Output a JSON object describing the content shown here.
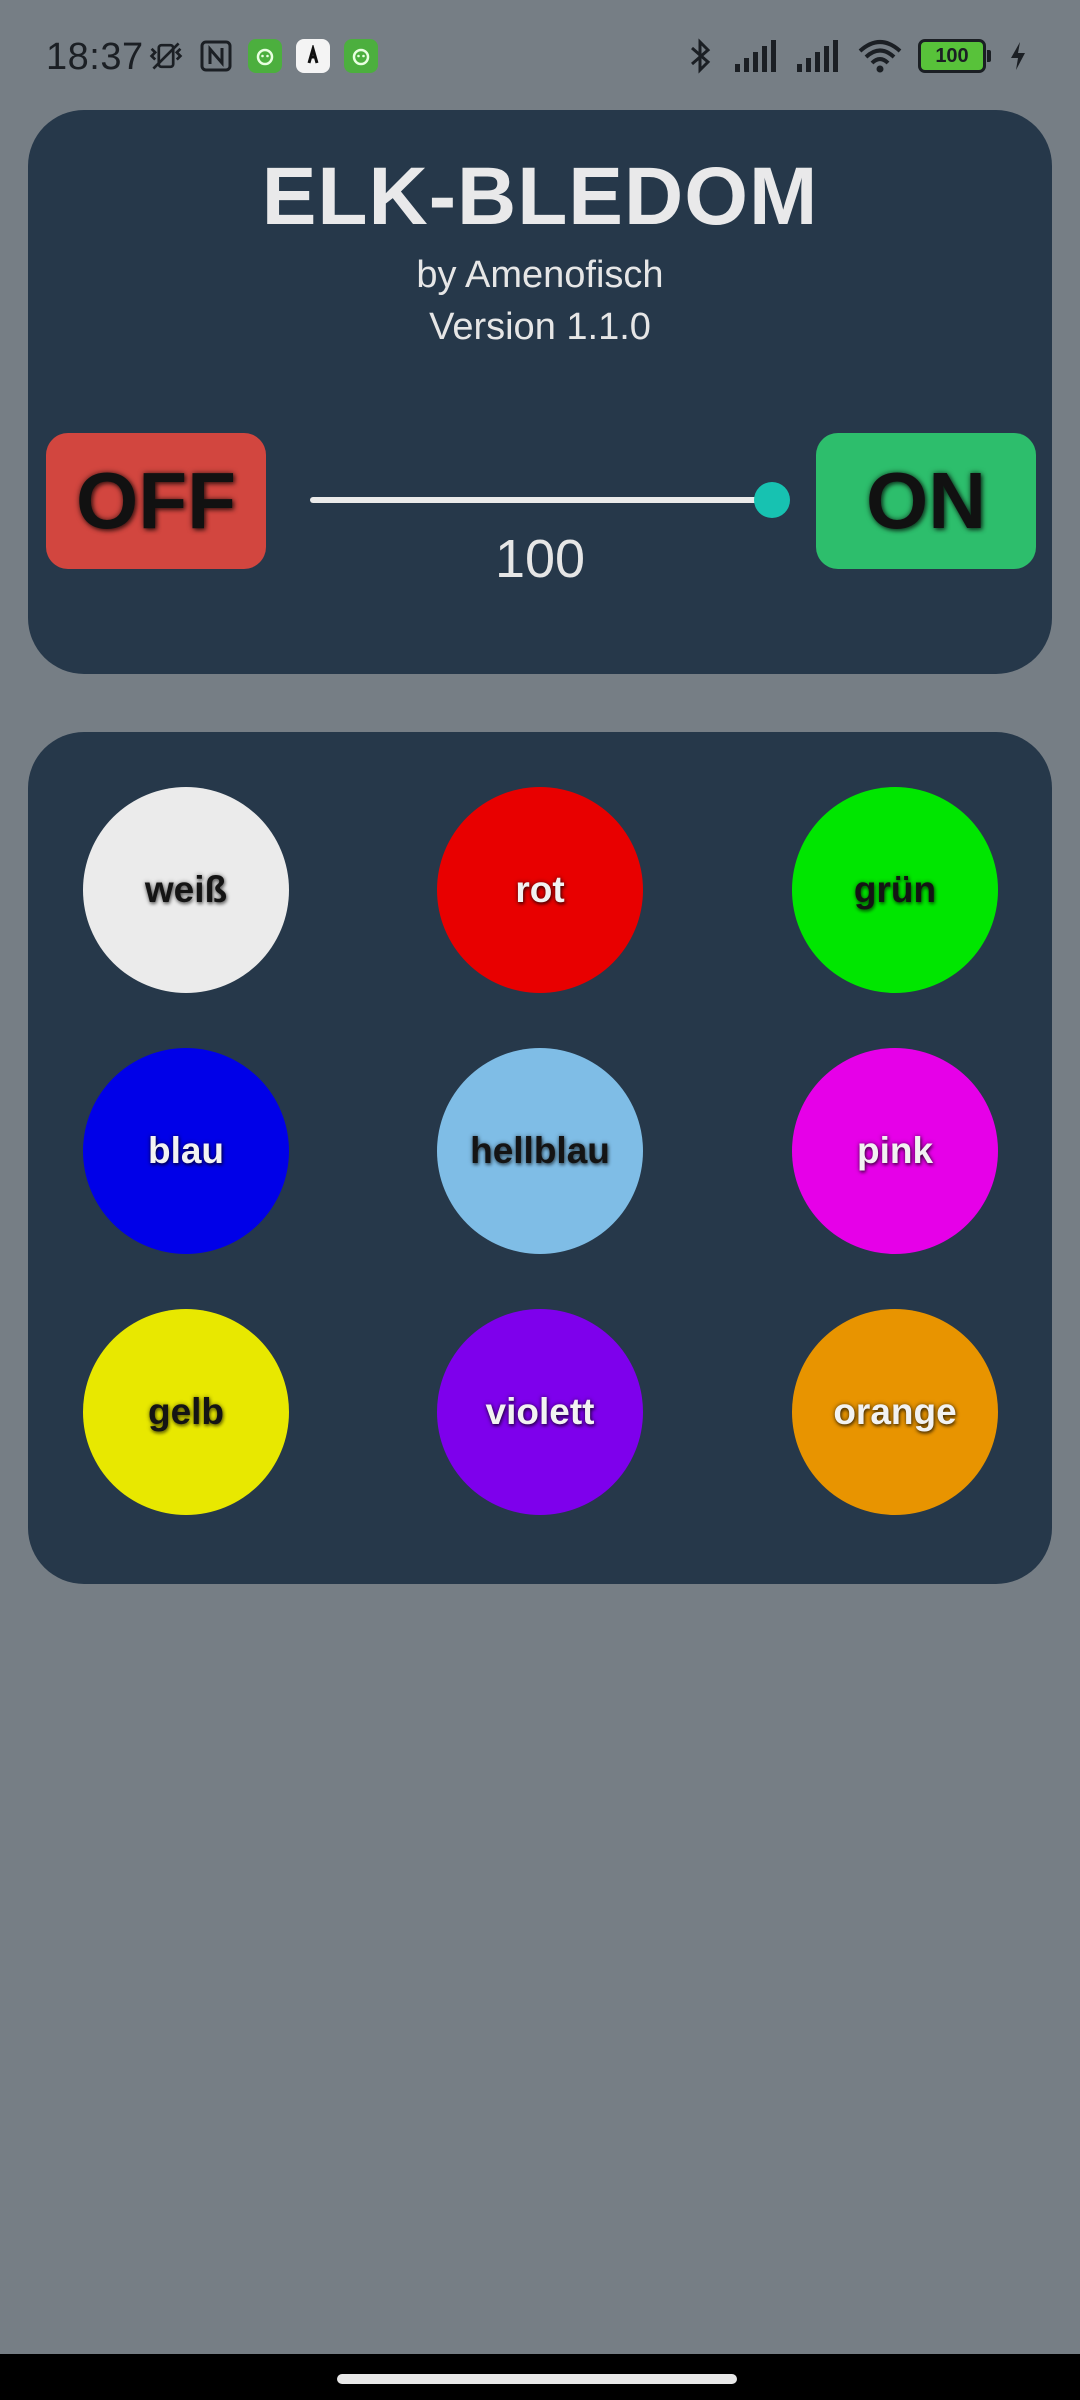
{
  "status_bar": {
    "time": "18:37",
    "left_icons": [
      "vibrate-off-icon",
      "nfc-icon",
      "app-notification-icon",
      "app-notification-icon",
      "app-notification-icon"
    ],
    "right_icons": [
      "bluetooth-icon",
      "signal-icon",
      "signal-icon",
      "wifi-icon"
    ],
    "battery_level": "100",
    "charging": true
  },
  "header": {
    "title": "ELK-BLEDOM",
    "byline": "by Amenofisch",
    "version": "Version 1.1.0"
  },
  "power": {
    "off_label": "OFF",
    "on_label": "ON",
    "off_color": "#d2463f",
    "on_color": "#2dbe6c"
  },
  "brightness": {
    "value": "100",
    "fraction": 1.0,
    "thumb_color": "#17c2b1"
  },
  "colors": [
    {
      "label": "weiß",
      "color": "#ebebeb",
      "text": "dark"
    },
    {
      "label": "rot",
      "color": "#e80000",
      "text": "light"
    },
    {
      "label": "grün",
      "color": "#00e600",
      "text": "dark"
    },
    {
      "label": "blau",
      "color": "#0000e8",
      "text": "light"
    },
    {
      "label": "hellblau",
      "color": "#7fbde6",
      "text": "dark"
    },
    {
      "label": "pink",
      "color": "#e600e8",
      "text": "light"
    },
    {
      "label": "gelb",
      "color": "#e8e800",
      "text": "dark"
    },
    {
      "label": "violett",
      "color": "#7e00ec",
      "text": "light"
    },
    {
      "label": "orange",
      "color": "#e89400",
      "text": "light"
    }
  ]
}
